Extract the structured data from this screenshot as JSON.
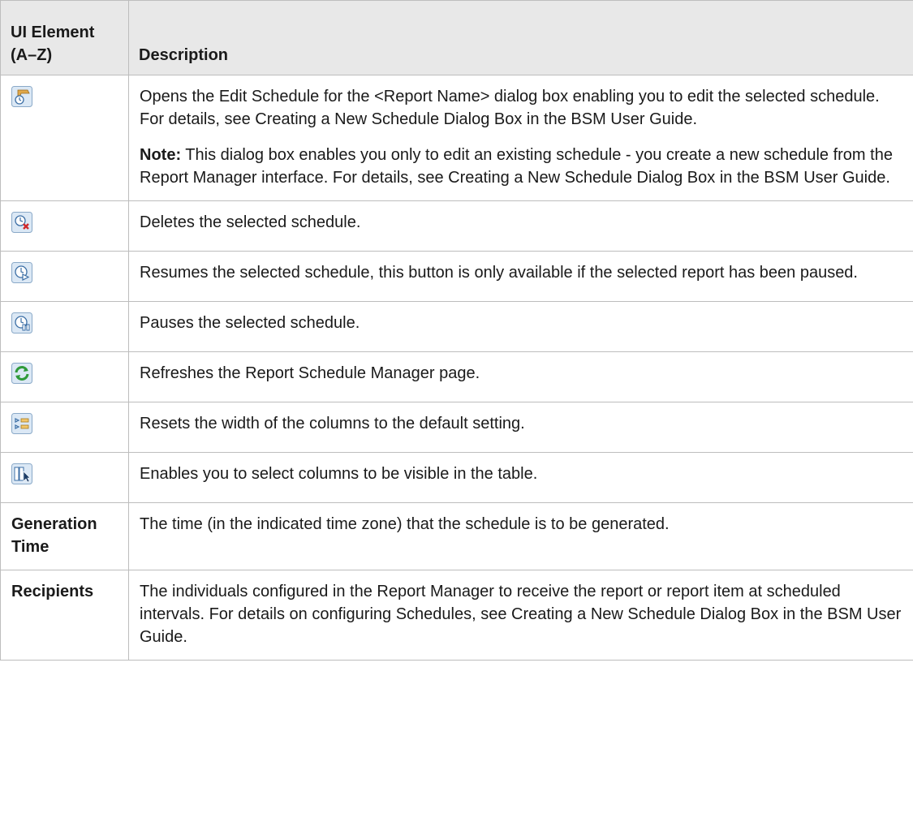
{
  "header": {
    "col1": "UI Element (A–Z)",
    "col2": "Description"
  },
  "rows": [
    {
      "icon": "edit-schedule-icon",
      "paragraphs": [
        "Opens the Edit Schedule for the <Report Name> dialog box enabling you to edit the selected schedule. For details, see Creating a New Schedule Dialog Box in the BSM User Guide."
      ],
      "note_label": "Note:",
      "note_text": " This dialog box enables you only to edit an existing schedule - you create a new schedule from the Report Manager interface. For details, see Creating a New Schedule Dialog Box in the BSM User Guide."
    },
    {
      "icon": "delete-schedule-icon",
      "description": "Deletes the selected schedule."
    },
    {
      "icon": "resume-schedule-icon",
      "description": "Resumes the selected schedule, this button is only available if the selected report has been paused."
    },
    {
      "icon": "pause-schedule-icon",
      "description": "Pauses the selected schedule."
    },
    {
      "icon": "refresh-icon",
      "description": "Refreshes the Report Schedule Manager page."
    },
    {
      "icon": "reset-columns-icon",
      "description": "Resets the width of the columns to the default setting."
    },
    {
      "icon": "select-columns-icon",
      "description": "Enables you to select columns to be visible in the table."
    },
    {
      "label": "Generation Time",
      "description": "The time (in the indicated time zone) that the schedule is to be generated."
    },
    {
      "label": "Recipients",
      "description": "The individuals configured in the Report Manager to receive the report or report item at scheduled intervals. For details on configuring Schedules, see Creating a New Schedule Dialog Box in the BSM User Guide."
    }
  ]
}
